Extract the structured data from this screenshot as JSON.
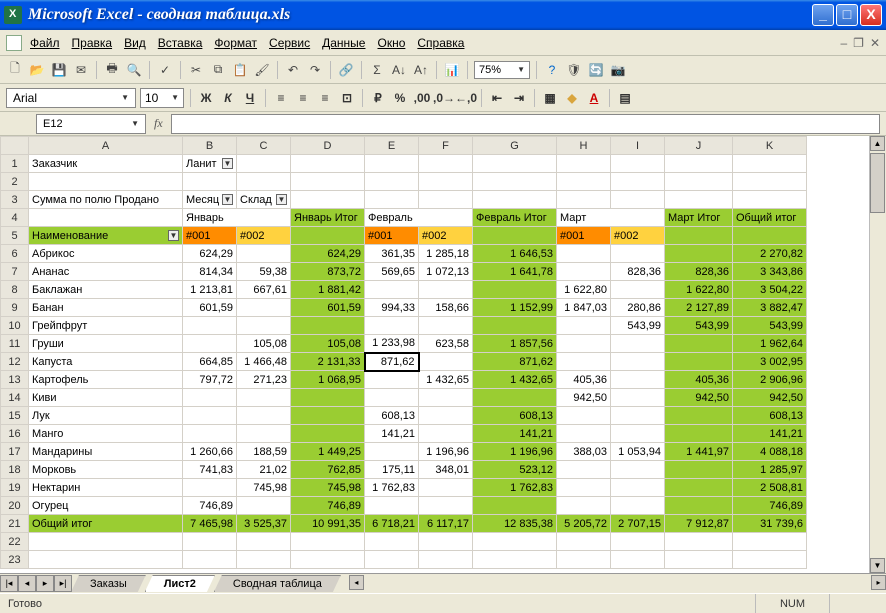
{
  "title": "Microsoft Excel - сводная таблица.xls",
  "menu": {
    "file": "Файл",
    "edit": "Правка",
    "view": "Вид",
    "insert": "Вставка",
    "format": "Формат",
    "tools": "Сервис",
    "data": "Данные",
    "window": "Окно",
    "help": "Справка"
  },
  "toolbar": {
    "zoom": "75%"
  },
  "format": {
    "font": "Arial",
    "size": "10"
  },
  "namebox": "E12",
  "tabs": {
    "t1": "Заказы",
    "t2": "Лист2",
    "t3": "Сводная таблица"
  },
  "status": {
    "ready": "Готово",
    "num": "NUM"
  },
  "chart_data": {
    "type": "table",
    "title": "Сумма по полю Продано",
    "filter_label": "Заказчик",
    "filter_value": "Ланит",
    "col_field": "Месяц",
    "col_sub": "Склад",
    "row_field": "Наименование",
    "months": [
      "Январь",
      "Февраль",
      "Март"
    ],
    "warehouses": [
      "#001",
      "#002"
    ],
    "totals_labels": {
      "month": "Итог",
      "grand_col": "Общий итог",
      "grand_row": "Общий итог",
      "jan": "Январь Итог",
      "feb": "Февраль Итог",
      "mar": "Март Итог"
    },
    "rows": [
      {
        "name": "Абрикос",
        "jan": [
          624.29,
          null
        ],
        "janT": 624.29,
        "feb": [
          361.35,
          1285.18
        ],
        "febT": 1646.53,
        "mar": [
          null,
          null
        ],
        "marT": null,
        "total": 2270.82
      },
      {
        "name": "Ананас",
        "jan": [
          814.34,
          59.38
        ],
        "janT": 873.72,
        "feb": [
          569.65,
          1072.13
        ],
        "febT": 1641.78,
        "mar": [
          null,
          828.36
        ],
        "marT": 828.36,
        "total": 3343.86
      },
      {
        "name": "Баклажан",
        "jan": [
          1213.81,
          667.61
        ],
        "janT": 1881.42,
        "feb": [
          null,
          null
        ],
        "febT": null,
        "mar": [
          1622.8,
          null
        ],
        "marT": 1622.8,
        "total": 3504.22
      },
      {
        "name": "Банан",
        "jan": [
          601.59,
          null
        ],
        "janT": 601.59,
        "feb": [
          994.33,
          158.66
        ],
        "febT": 1152.99,
        "mar": [
          1847.03,
          280.86
        ],
        "marT": 2127.89,
        "total": 3882.47
      },
      {
        "name": "Грейпфрут",
        "jan": [
          null,
          null
        ],
        "janT": null,
        "feb": [
          null,
          null
        ],
        "febT": null,
        "mar": [
          null,
          543.99
        ],
        "marT": 543.99,
        "total": 543.99
      },
      {
        "name": "Груши",
        "jan": [
          null,
          105.08
        ],
        "janT": 105.08,
        "feb": [
          1233.98,
          623.58
        ],
        "febT": 1857.56,
        "mar": [
          null,
          null
        ],
        "marT": null,
        "total": 1962.64
      },
      {
        "name": "Капуста",
        "jan": [
          664.85,
          1466.48
        ],
        "janT": 2131.33,
        "feb": [
          871.62,
          null
        ],
        "febT": 871.62,
        "mar": [
          null,
          null
        ],
        "marT": null,
        "total": 3002.95
      },
      {
        "name": "Картофель",
        "jan": [
          797.72,
          271.23
        ],
        "janT": 1068.95,
        "feb": [
          null,
          1432.65
        ],
        "febT": 1432.65,
        "mar": [
          405.36,
          null
        ],
        "marT": 405.36,
        "total": 2906.96
      },
      {
        "name": "Киви",
        "jan": [
          null,
          null
        ],
        "janT": null,
        "feb": [
          null,
          null
        ],
        "febT": null,
        "mar": [
          942.5,
          null
        ],
        "marT": 942.5,
        "total": 942.5
      },
      {
        "name": "Лук",
        "jan": [
          null,
          null
        ],
        "janT": null,
        "feb": [
          608.13,
          null
        ],
        "febT": 608.13,
        "mar": [
          null,
          null
        ],
        "marT": null,
        "total": 608.13
      },
      {
        "name": "Манго",
        "jan": [
          null,
          null
        ],
        "janT": null,
        "feb": [
          141.21,
          null
        ],
        "febT": 141.21,
        "mar": [
          null,
          null
        ],
        "marT": null,
        "total": 141.21
      },
      {
        "name": "Мандарины",
        "jan": [
          1260.66,
          188.59
        ],
        "janT": 1449.25,
        "feb": [
          null,
          1196.96
        ],
        "febT": 1196.96,
        "mar": [
          388.03,
          1053.94
        ],
        "marT": 1441.97,
        "total": 4088.18
      },
      {
        "name": "Морковь",
        "jan": [
          741.83,
          21.02
        ],
        "janT": 762.85,
        "feb": [
          175.11,
          348.01
        ],
        "febT": 523.12,
        "mar": [
          null,
          null
        ],
        "marT": null,
        "total": 1285.97
      },
      {
        "name": "Нектарин",
        "jan": [
          null,
          745.98
        ],
        "janT": 745.98,
        "feb": [
          1762.83,
          null
        ],
        "febT": 1762.83,
        "mar": [
          null,
          null
        ],
        "marT": null,
        "total": 2508.81
      },
      {
        "name": "Огурец",
        "jan": [
          746.89,
          null
        ],
        "janT": 746.89,
        "feb": [
          null,
          null
        ],
        "febT": null,
        "mar": [
          null,
          null
        ],
        "marT": null,
        "total": 746.89
      }
    ],
    "grand": {
      "jan": [
        7465.98,
        3525.37
      ],
      "janT": 10991.35,
      "feb": [
        6718.21,
        6117.17
      ],
      "febT": 12835.38,
      "mar": [
        5205.72,
        2707.15
      ],
      "marT": 7912.87,
      "total": 31739.6
    }
  }
}
